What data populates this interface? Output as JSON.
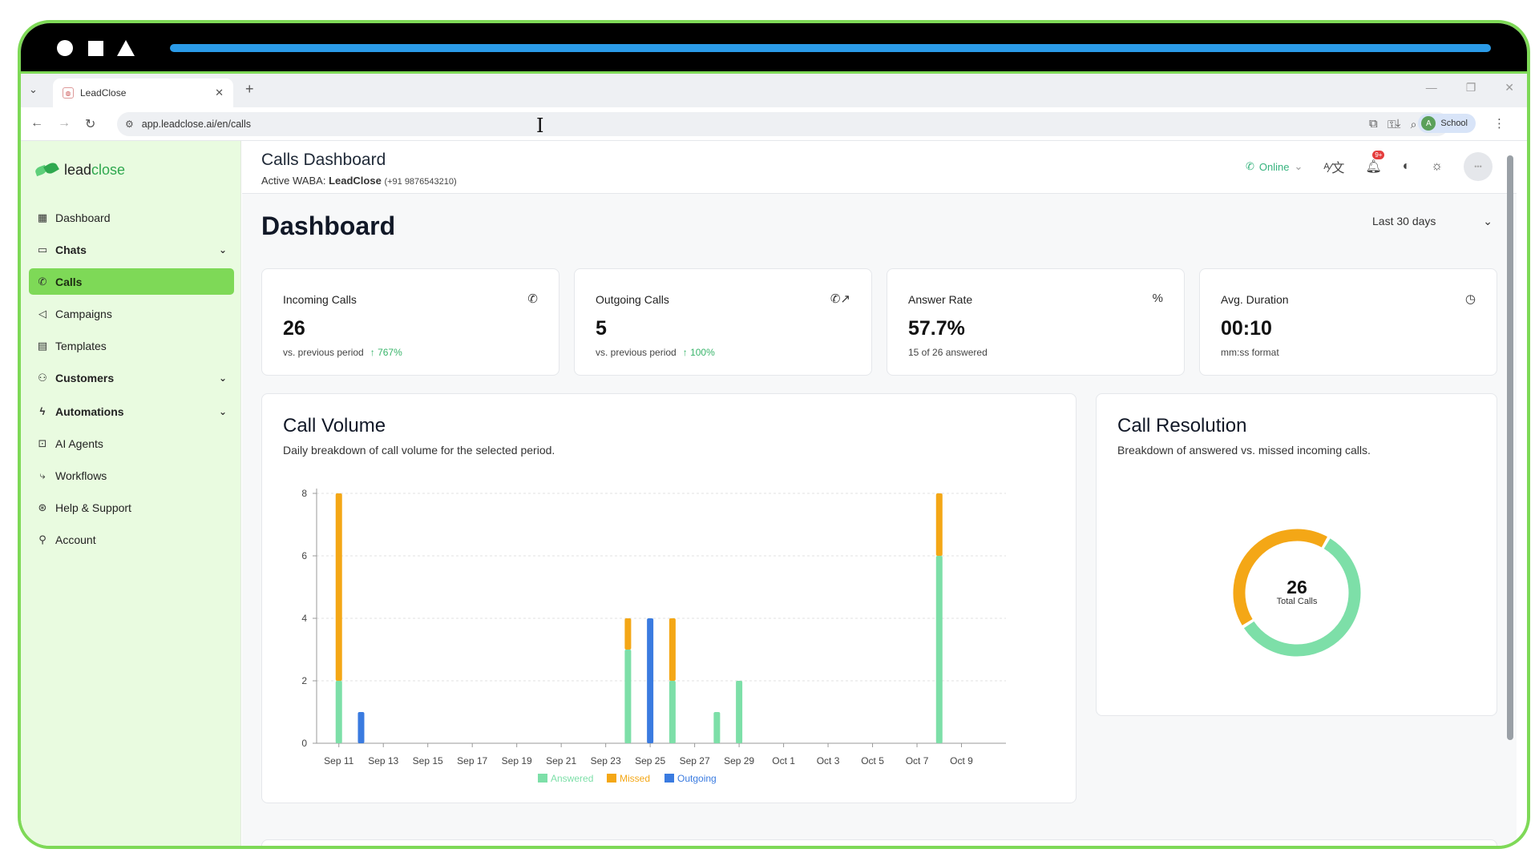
{
  "browser": {
    "tab_title": "LeadClose",
    "url": "app.leadclose.ai/en/calls",
    "profile_initial": "A",
    "profile_label": "School"
  },
  "sidebar": {
    "logo_lead": "lead",
    "logo_close": "close",
    "items": [
      {
        "label": "Dashboard",
        "icon": "grid-icon"
      },
      {
        "label": "Chats",
        "icon": "chat-icon",
        "expandable": true
      },
      {
        "label": "Calls",
        "icon": "phone-icon",
        "active": true
      },
      {
        "label": "Campaigns",
        "icon": "megaphone-icon"
      },
      {
        "label": "Templates",
        "icon": "file-icon"
      },
      {
        "label": "Customers",
        "icon": "users-icon",
        "expandable": true
      },
      {
        "label": "Automations",
        "icon": "bolt-icon",
        "expandable": true
      },
      {
        "label": "AI Agents",
        "icon": "bot-icon"
      },
      {
        "label": "Workflows",
        "icon": "workflow-icon"
      },
      {
        "label": "Help & Support",
        "icon": "lifebuoy-icon"
      },
      {
        "label": "Account",
        "icon": "user-cog-icon"
      }
    ]
  },
  "header": {
    "title": "Calls Dashboard",
    "waba_prefix": "Active WABA:",
    "waba_name": "LeadClose",
    "waba_phone": "(+91 9876543210)",
    "status": "Online",
    "notification_count": "9+"
  },
  "page": {
    "title": "Dashboard",
    "range": "Last 30 days"
  },
  "stats": [
    {
      "label": "Incoming Calls",
      "value": "26",
      "sub": "vs. previous period",
      "change": "767%",
      "icon": "phone-icon"
    },
    {
      "label": "Outgoing Calls",
      "value": "5",
      "sub": "vs. previous period",
      "change": "100%",
      "icon": "phone-outgoing-icon"
    },
    {
      "label": "Answer Rate",
      "value": "57.7%",
      "sub": "15 of 26 answered",
      "change": "",
      "icon": "percent-icon"
    },
    {
      "label": "Avg. Duration",
      "value": "00:10",
      "sub": "mm:ss format",
      "change": "",
      "icon": "timer-icon"
    }
  ],
  "volume_panel": {
    "title": "Call Volume",
    "subtitle": "Daily breakdown of call volume for the selected period."
  },
  "resolution_panel": {
    "title": "Call Resolution",
    "subtitle": "Breakdown of answered vs. missed incoming calls.",
    "center_value": "26",
    "center_label": "Total Calls"
  },
  "colors": {
    "answered": "#7ddfa8",
    "missed": "#f4a716",
    "outgoing": "#3a7be0",
    "accent": "#7ed957"
  },
  "chart_data": [
    {
      "type": "bar",
      "stacked": true,
      "x_ticks": [
        "Sep 11",
        "Sep 13",
        "Sep 15",
        "Sep 17",
        "Sep 19",
        "Sep 21",
        "Sep 23",
        "Sep 25",
        "Sep 27",
        "Sep 29",
        "Oct 1",
        "Oct 3",
        "Oct 5",
        "Oct 7",
        "Oct 9"
      ],
      "y_ticks": [
        0,
        2,
        4,
        6,
        8
      ],
      "ylim": [
        0,
        8
      ],
      "grid": true,
      "legend": "bottom",
      "days": [
        "Sep 11",
        "Sep 12",
        "Sep 24",
        "Sep 25",
        "Sep 26",
        "Sep 28",
        "Sep 29",
        "Oct 8"
      ],
      "series": [
        {
          "name": "Answered",
          "stack": "incoming",
          "values": [
            2,
            0,
            3,
            0,
            2,
            1,
            2,
            6
          ]
        },
        {
          "name": "Missed",
          "stack": "incoming",
          "values": [
            6,
            0,
            1,
            0,
            2,
            0,
            0,
            2
          ]
        },
        {
          "name": "Outgoing",
          "stack": "outgoing",
          "values": [
            0,
            1,
            0,
            4,
            0,
            0,
            0,
            0
          ]
        }
      ]
    },
    {
      "type": "pie",
      "donut": true,
      "categories": [
        "Answered",
        "Missed"
      ],
      "values": [
        15,
        11
      ]
    }
  ]
}
